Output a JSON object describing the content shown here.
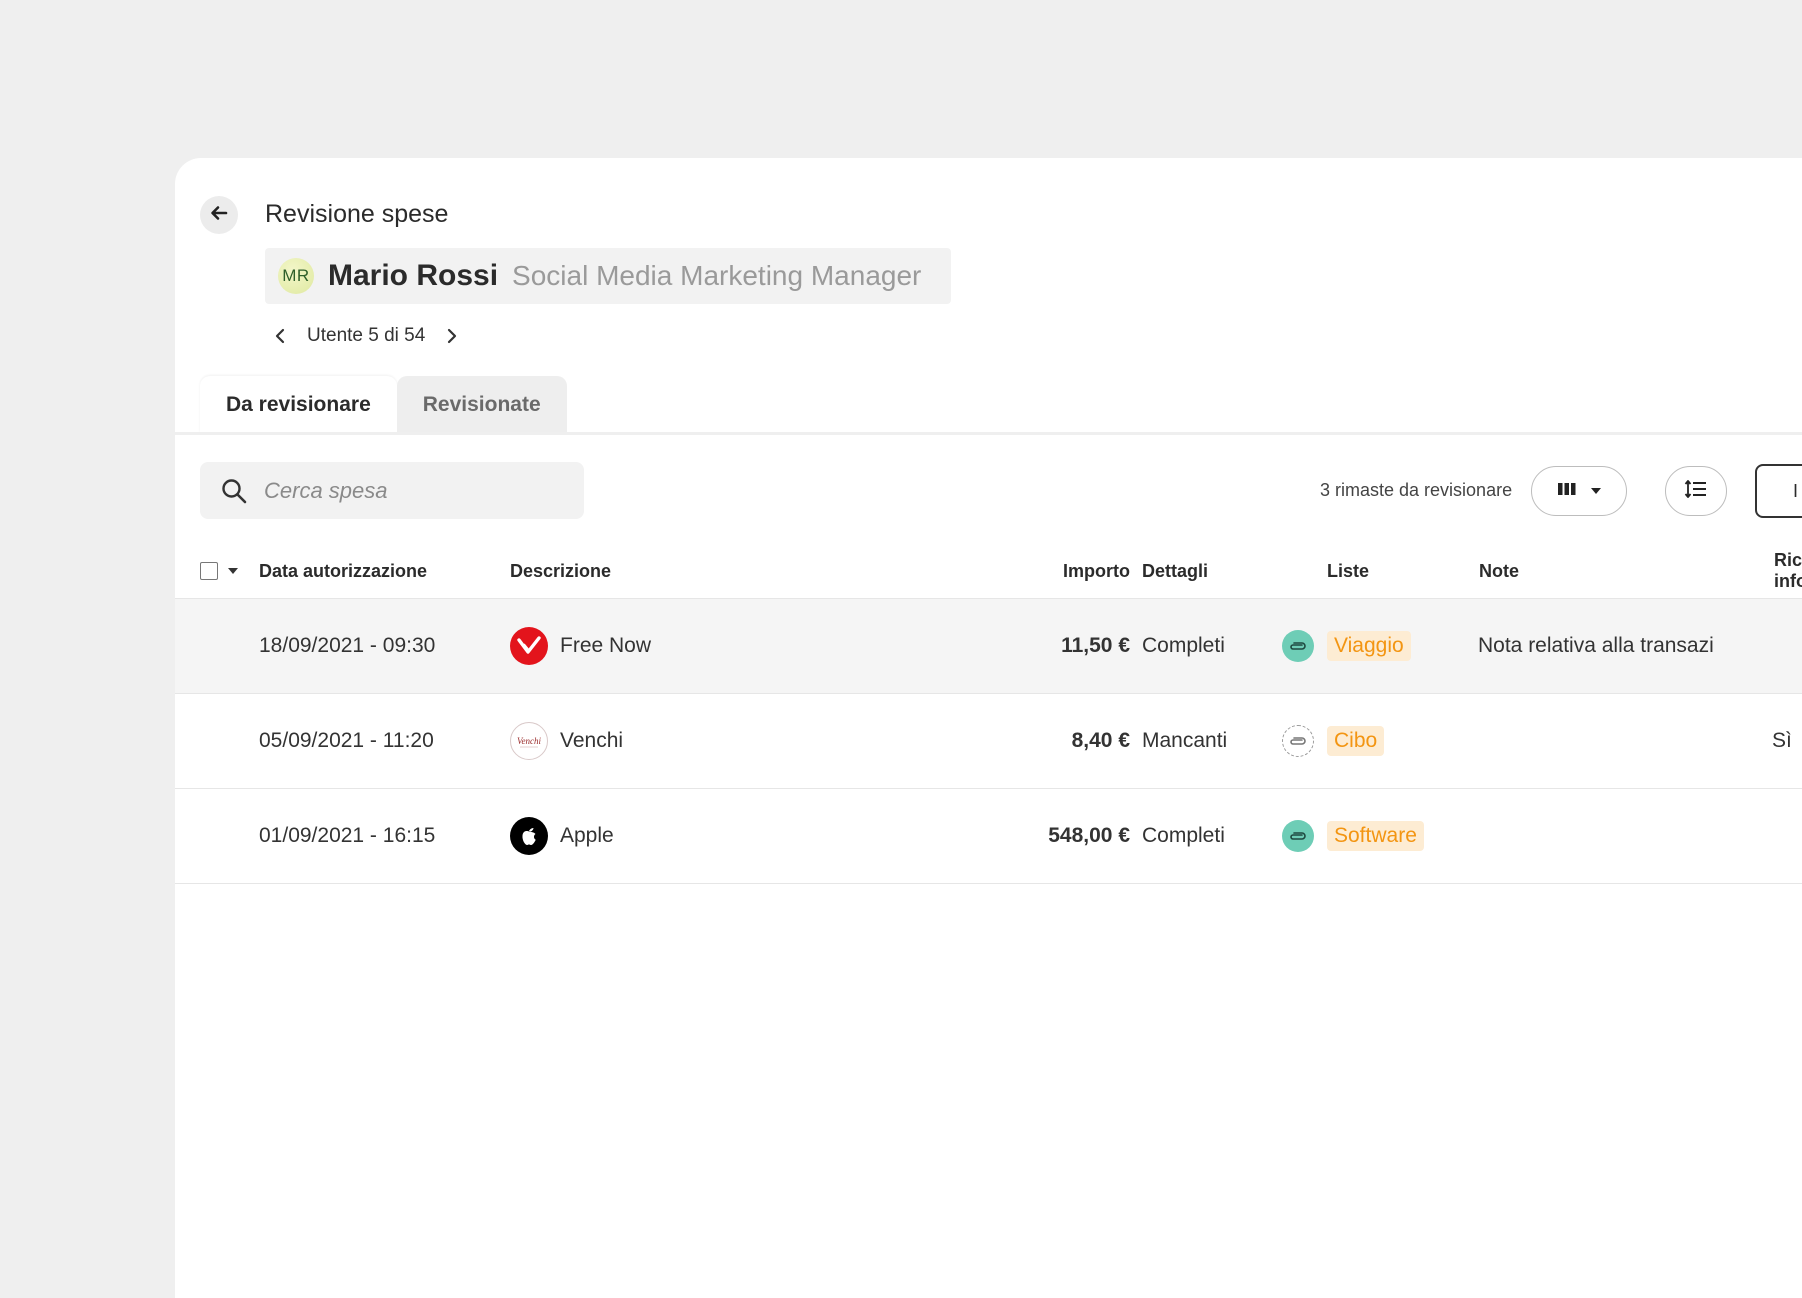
{
  "header": {
    "title": "Revisione spese",
    "back_icon": "arrow-left-icon"
  },
  "user": {
    "initials": "MR",
    "name": "Mario Rossi",
    "role": "Social Media Marketing Manager"
  },
  "pager": {
    "label": "Utente 5 di 54"
  },
  "tabs": [
    {
      "label": "Da revisionare",
      "active": true
    },
    {
      "label": "Revisionate",
      "active": false
    }
  ],
  "toolbar": {
    "search_placeholder": "Cerca spesa",
    "remaining": "3 rimaste da revisionare",
    "partial_button_label": "I"
  },
  "table": {
    "columns": [
      "Data autorizzazione",
      "Descrizione",
      "Importo",
      "Dettagli",
      "Liste",
      "Note",
      "Richiesta info"
    ],
    "rows": [
      {
        "date": "18/09/2021 - 09:30",
        "merchant": "Free Now",
        "amount": "11,50 €",
        "details": "Completi",
        "receipt": "attached",
        "list": "Viaggio",
        "note": "Nota relativa alla transazi",
        "info_request": ""
      },
      {
        "date": "05/09/2021 - 11:20",
        "merchant": "Venchi",
        "amount": "8,40 €",
        "details": "Mancanti",
        "receipt": "missing",
        "list": "Cibo",
        "note": "",
        "info_request": "Sì"
      },
      {
        "date": "01/09/2021 - 16:15",
        "merchant": "Apple",
        "amount": "548,00 €",
        "details": "Completi",
        "receipt": "attached",
        "list": "Software",
        "note": "",
        "info_request": ""
      }
    ]
  },
  "colors": {
    "background": "#efefef",
    "panel": "#ffffff",
    "tag_bg": "#fdecd3",
    "tag_text": "#f39512",
    "clip_filled": "#6ecdb6",
    "freenow_red": "#e3141c"
  }
}
